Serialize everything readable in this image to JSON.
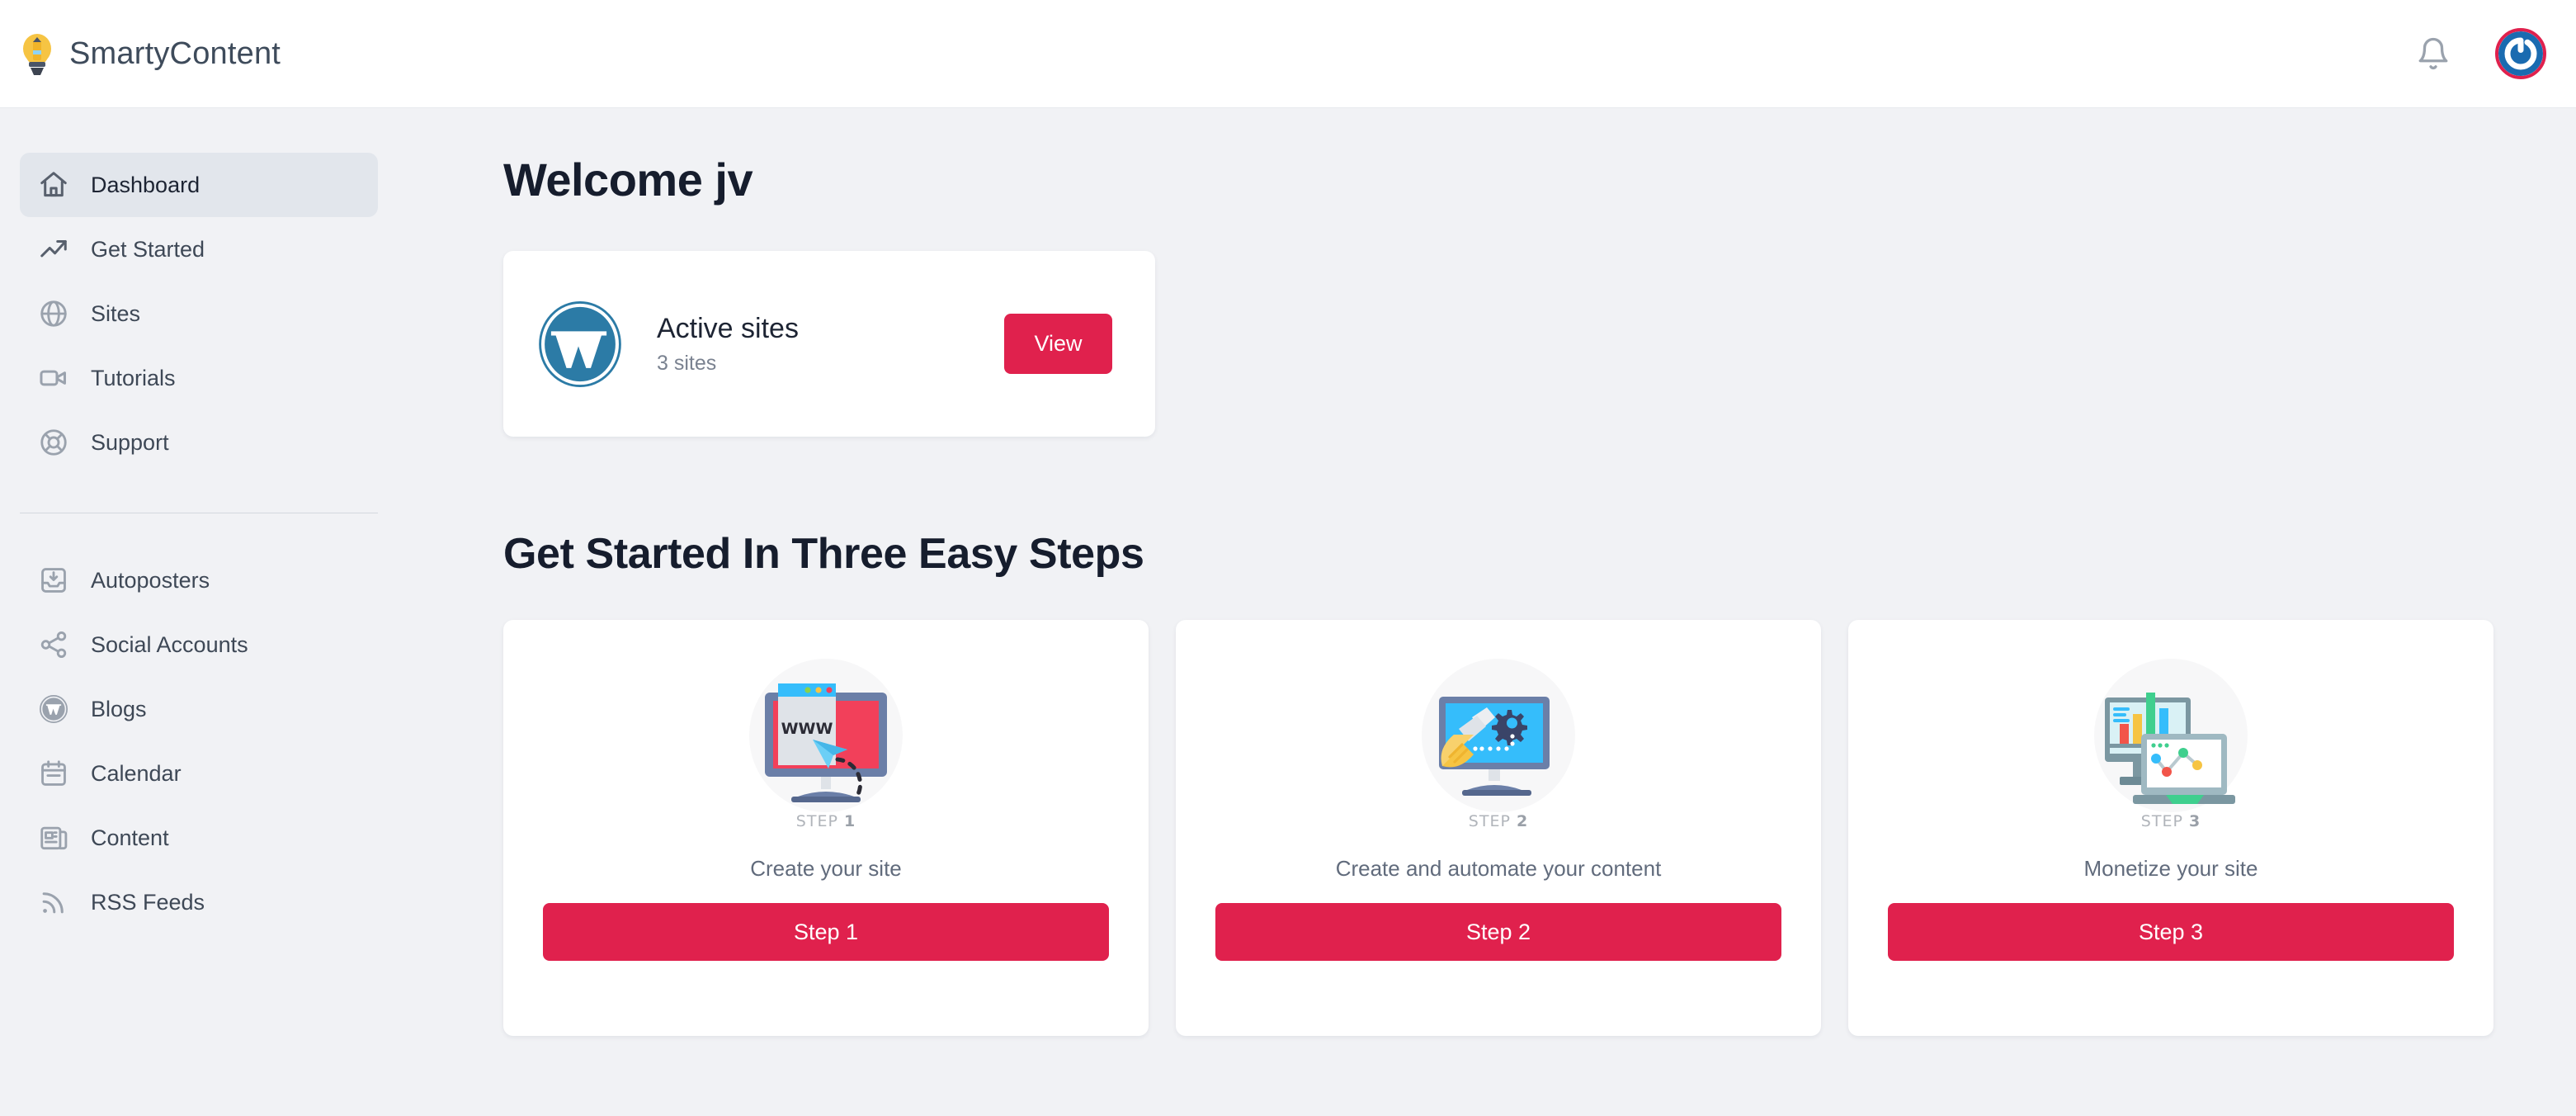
{
  "header": {
    "brand_name": "SmartyContent",
    "logo_icon": "lightbulb-pencil-icon",
    "notifications_icon": "bell-icon",
    "avatar_icon": "user-avatar-gravatar"
  },
  "sidebar": {
    "primary_items": [
      {
        "label": "Dashboard",
        "icon": "home-icon",
        "active": true
      },
      {
        "label": "Get Started",
        "icon": "trending-up-icon",
        "active": false
      },
      {
        "label": "Sites",
        "icon": "globe-icon",
        "active": false
      },
      {
        "label": "Tutorials",
        "icon": "video-camera-icon",
        "active": false
      },
      {
        "label": "Support",
        "icon": "lifebuoy-icon",
        "active": false
      }
    ],
    "secondary_items": [
      {
        "label": "Autoposters",
        "icon": "inbox-download-icon"
      },
      {
        "label": "Social Accounts",
        "icon": "share-network-icon"
      },
      {
        "label": "Blogs",
        "icon": "wordpress-icon"
      },
      {
        "label": "Calendar",
        "icon": "calendar-icon"
      },
      {
        "label": "Content",
        "icon": "newspaper-icon"
      },
      {
        "label": "RSS Feeds",
        "icon": "rss-icon"
      }
    ]
  },
  "main": {
    "welcome_title": "Welcome jv",
    "active_sites_card": {
      "icon": "wordpress-icon",
      "title": "Active sites",
      "subtitle": "3 sites",
      "view_button": "View"
    },
    "get_started_title": "Get Started In Three Easy Steps",
    "steps": [
      {
        "illustration": "monitor-www-cursor-illustration",
        "step_badge": "STEP 1",
        "caption": "Create your site",
        "button": "Step 1"
      },
      {
        "illustration": "monitor-screwdriver-gear-illustration",
        "step_badge": "STEP 2",
        "caption": "Create and automate your content",
        "button": "Step 2"
      },
      {
        "illustration": "monitor-laptop-charts-illustration",
        "step_badge": "STEP 3",
        "caption": "Monetize your site",
        "button": "Step 3"
      }
    ]
  },
  "colors": {
    "accent": "#e0214d",
    "page_background": "#f1f2f5",
    "sidebar_active": "#e2e6ec",
    "text_dark": "#161d2d",
    "text_muted": "#7a8290",
    "wordpress_blue": "#21759b"
  }
}
